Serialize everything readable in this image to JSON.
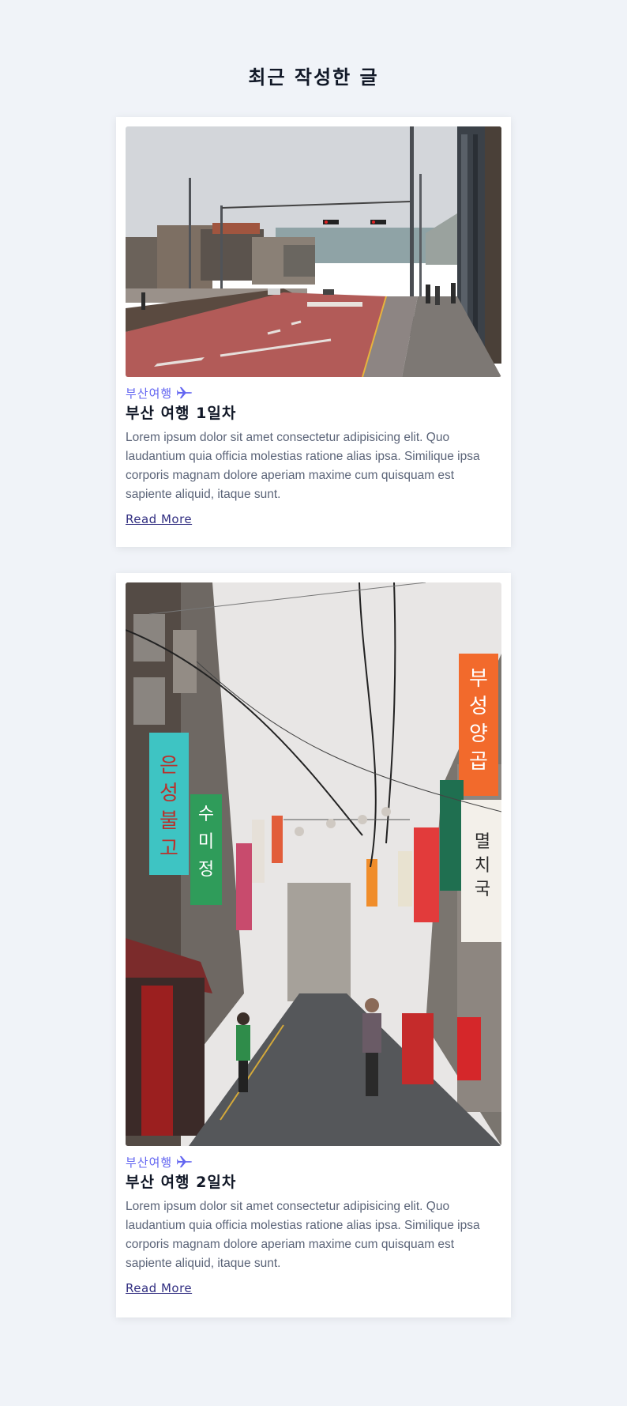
{
  "page": {
    "title": "최근 작성한 글"
  },
  "posts": [
    {
      "category": "부산여행",
      "category_icon": "plane-icon",
      "title": "부산 여행 1일차",
      "excerpt": "Lorem ipsum dolor sit amet consectetur adipisicing elit. Quo laudantium quia officia molestias ratione alias ipsa. Similique ipsa corporis magnam dolore aperiam maxime cum quisquam est sapiente aliquid, itaque sunt.",
      "read_more": "Read More",
      "photo": "busan-street-photo"
    },
    {
      "category": "부산여행",
      "category_icon": "plane-icon",
      "title": "부산 여행 2일차",
      "excerpt": "Lorem ipsum dolor sit amet consectetur adipisicing elit. Quo laudantium quia officia molestias ratione alias ipsa. Similique ipsa corporis magnam dolore aperiam maxime cum quisquam est sapiente aliquid, itaque sunt.",
      "read_more": "Read More",
      "photo": "busan-market-alley-photo"
    }
  ],
  "colors": {
    "background": "#f0f3f8",
    "accent": "#6366f1",
    "link": "#312e81",
    "title": "#111827",
    "body_text": "#5b6478"
  }
}
